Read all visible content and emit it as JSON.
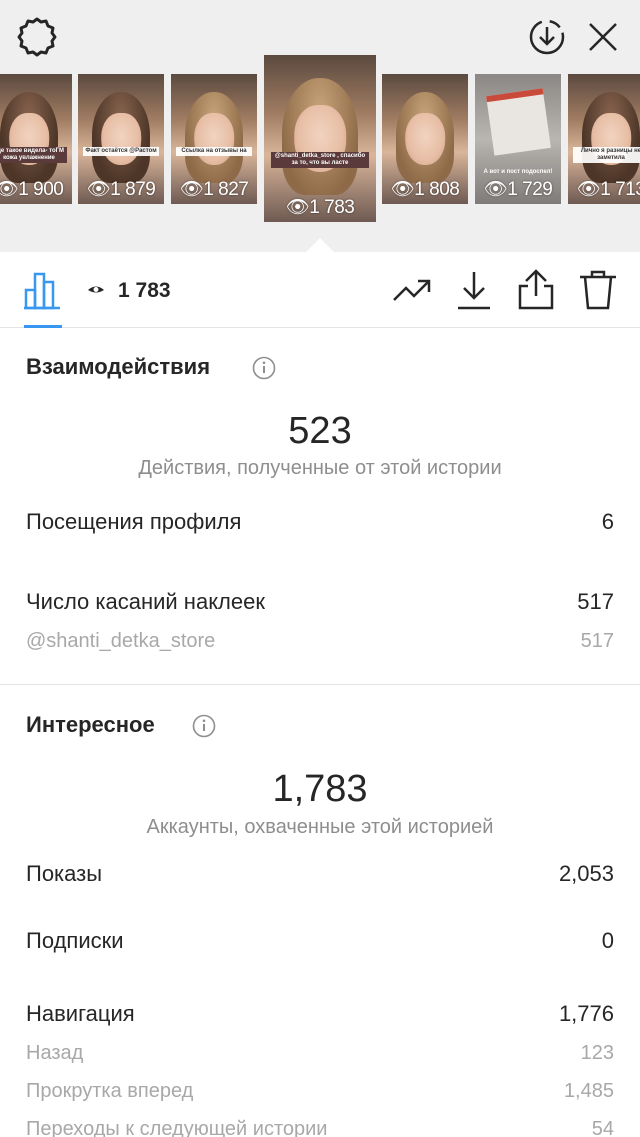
{
  "stories": [
    {
      "caption": "Где такое видела- тоГМ  кожа увлажнение",
      "views": "1 900",
      "style": "dark-hair"
    },
    {
      "caption": "Факт остаётся @Растом",
      "views": "1 879",
      "style": "dark-hair"
    },
    {
      "caption": "Ссылка на отзывы на",
      "views": "1 827",
      "style": "blond"
    },
    {
      "caption": "@shanti_detka_store , спасибо за то, что вы ласте",
      "views": "1 783",
      "style": "blond",
      "selected": true
    },
    {
      "caption": "",
      "views": "1 808",
      "style": "blond"
    },
    {
      "caption": "А вот и пост подоспел!",
      "views": "1 729",
      "style": "gray"
    },
    {
      "caption": "Лично я разницы не заметила",
      "views": "1 713",
      "style": "dark-hair"
    }
  ],
  "toolbar": {
    "views": "1 783"
  },
  "interactions": {
    "title": "Взаимодействия",
    "total": "523",
    "total_caption": "Действия, полученные от этой истории",
    "rows": [
      {
        "label": "Посещения профиля",
        "value": "6"
      },
      {
        "label": "Число касаний наклеек",
        "value": "517"
      },
      {
        "label": "@shanti_detka_store",
        "value": "517"
      }
    ]
  },
  "discovery": {
    "title": "Интересное",
    "total": "1,783",
    "total_caption": "Аккаунты, охваченные этой историей",
    "rows": [
      {
        "label": "Показы",
        "value": "2,053"
      },
      {
        "label": "Подписки",
        "value": "0"
      },
      {
        "label": "Навигация",
        "value": "1,776"
      },
      {
        "label": "Назад",
        "value": "123"
      },
      {
        "label": "Прокрутка вперед",
        "value": "1,485"
      },
      {
        "label": "Переходы к следующей истории",
        "value": "54"
      }
    ]
  },
  "colors": {
    "accent": "#3897f0",
    "text": "#262626",
    "muted": "#8e8e8e"
  }
}
